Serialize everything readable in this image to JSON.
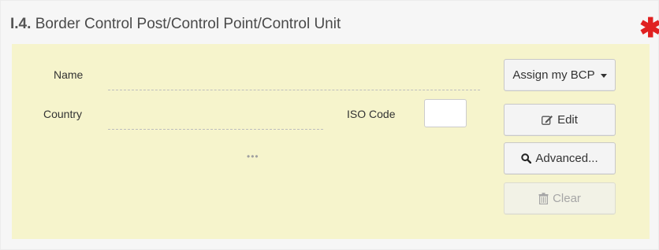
{
  "section": {
    "number": "I.4.",
    "title": "Border Control Post/Control Point/Control Unit",
    "required_marker": "✱"
  },
  "form": {
    "name_label": "Name",
    "name_value": "",
    "country_label": "Country",
    "country_value": "",
    "iso_code_label": "ISO Code",
    "iso_code_value": "",
    "more_indicator": "•••"
  },
  "buttons": {
    "assign": "Assign my BCP",
    "edit": "Edit",
    "advanced": "Advanced...",
    "clear": "Clear"
  },
  "icons": {
    "edit": "edit-icon",
    "advanced": "search-icon",
    "clear": "trash-icon",
    "assign": "caret-down-icon"
  },
  "colors": {
    "content_background": "#f6f4cc",
    "required": "#e02020"
  }
}
